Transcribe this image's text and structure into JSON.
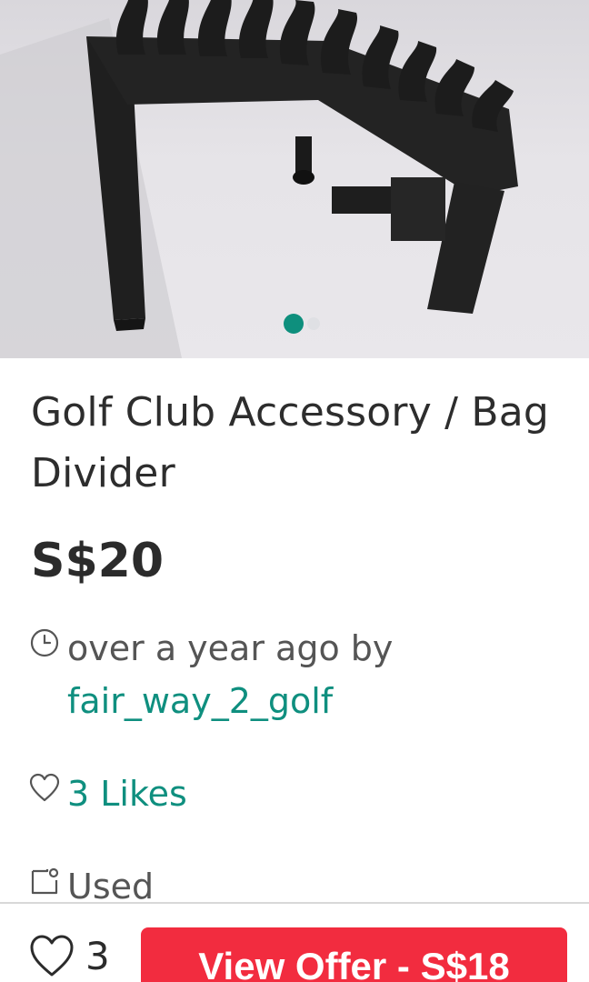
{
  "product": {
    "title": "Golf Club Accessory / Bag Divider",
    "price": "S$20"
  },
  "carousel": {
    "total": 2,
    "active_index": 0
  },
  "meta": {
    "posted": "over a year ago by",
    "seller": "fair_way_2_golf",
    "likes": "3 Likes",
    "condition": "Used"
  },
  "bottom_bar": {
    "like_count": "3",
    "offer_button": "View Offer - S$18"
  },
  "colors": {
    "accent": "#0f8f7f",
    "offer": "#f22c3f"
  },
  "icons": [
    "clock-icon",
    "heart-icon",
    "tag-icon"
  ]
}
